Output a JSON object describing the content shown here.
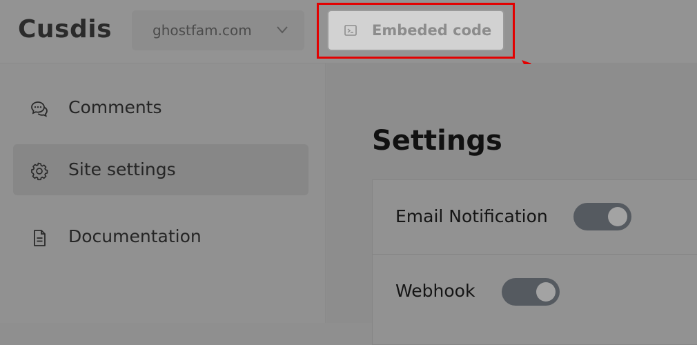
{
  "header": {
    "logo": "Cusdis",
    "site_selector": {
      "value": "ghostfam.com"
    },
    "embed_button": {
      "label": "Embeded code"
    }
  },
  "sidebar": {
    "items": [
      {
        "label": "Comments",
        "icon": "chat-bubbles-icon",
        "active": false
      },
      {
        "label": "Site settings",
        "icon": "gear-icon",
        "active": true
      },
      {
        "label": "Documentation",
        "icon": "document-icon",
        "active": false
      }
    ]
  },
  "main": {
    "title": "Settings",
    "settings": [
      {
        "label": "Email Notification",
        "enabled": true
      },
      {
        "label": "Webhook",
        "enabled": true
      }
    ]
  },
  "colors": {
    "highlight": "#e30000",
    "toggle_on": "#555a60"
  }
}
